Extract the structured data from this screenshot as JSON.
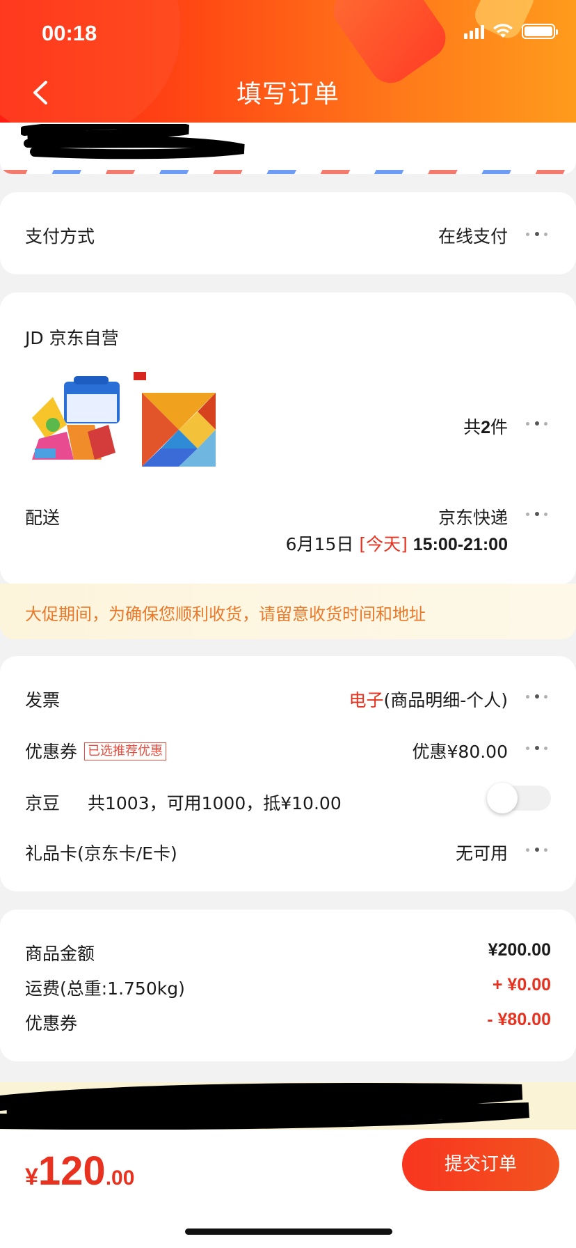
{
  "status_bar": {
    "time": "00:18"
  },
  "header": {
    "title": "填写订单"
  },
  "payment": {
    "label": "支付方式",
    "value": "在线支付"
  },
  "shop": {
    "name": "JD 京东自营",
    "count_prefix": "共",
    "count": "2",
    "count_suffix": "件"
  },
  "delivery": {
    "label": "配送",
    "carrier": "京东快递",
    "date": "6月15日",
    "day_tag": "[今天]",
    "time_window": "15:00-21:00"
  },
  "promo_notice": "大促期间，为确保您顺利收货，请留意收货时间和地址",
  "invoice": {
    "label": "发票",
    "type": "电子",
    "detail": "(商品明细-个人)"
  },
  "coupon": {
    "label": "优惠券",
    "tag": "已选推荐优惠",
    "value": "优惠¥80.00"
  },
  "jingdou": {
    "label": "京豆",
    "info": "共1003，可用1000，抵¥10.00",
    "enabled": false
  },
  "gift_card": {
    "label": "礼品卡(京东卡/E卡)",
    "value": "无可用"
  },
  "summary": {
    "goods_label": "商品金额",
    "goods_value": "¥200.00",
    "freight_label": "运费(总重:1.750kg)",
    "freight_value": "+ ¥0.00",
    "coupon_label": "优惠券",
    "coupon_value": "- ¥80.00"
  },
  "footer": {
    "currency": "¥",
    "total_int": "120",
    "total_dec": ".00",
    "submit_label": "提交订单"
  },
  "colors": {
    "accent": "#e8321f",
    "promo_text": "#e8782a",
    "header_start": "#ff1e12",
    "header_end": "#ff9b1c"
  },
  "icons": [
    "back-arrow-icon",
    "more-dots-icon",
    "signal-icon",
    "wifi-icon",
    "battery-icon"
  ]
}
